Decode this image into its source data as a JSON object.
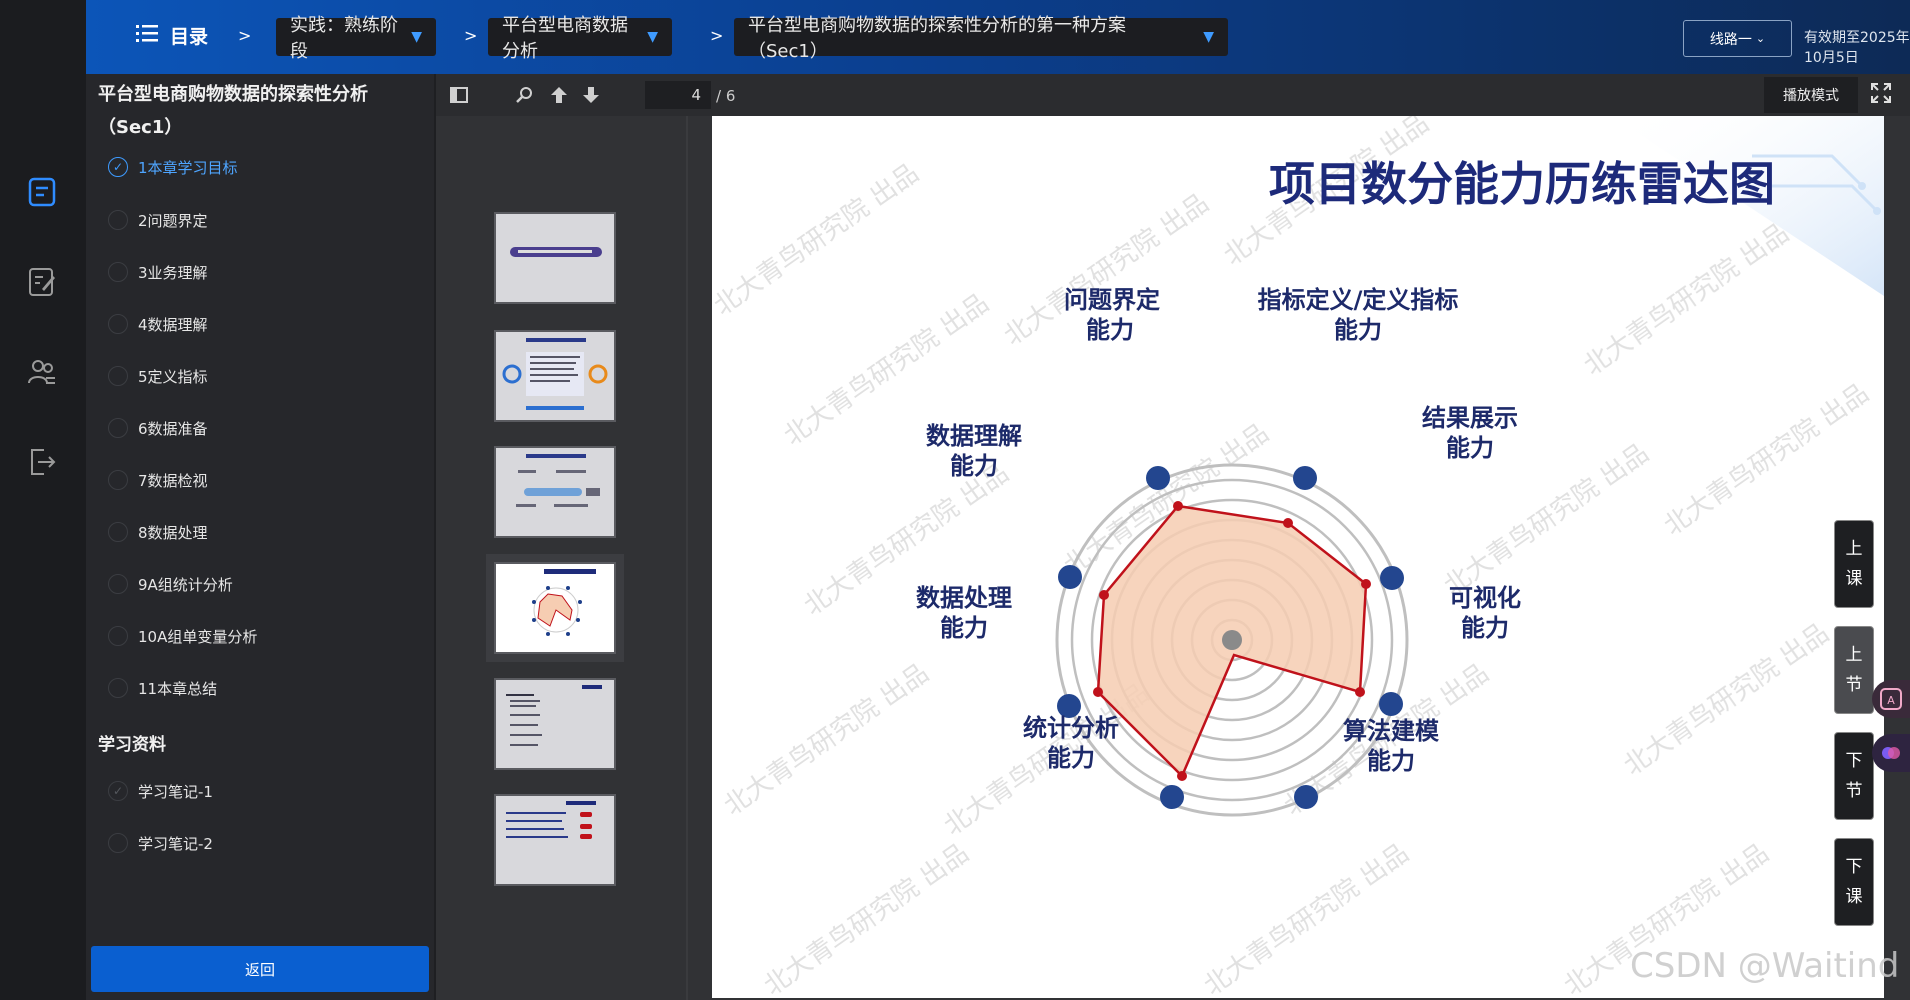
{
  "topbar": {
    "menu_label": "目录",
    "sep": ">",
    "crumbs": [
      "实践：熟练阶段",
      "平台型电商数据分析",
      "平台型电商购物数据的探索性分析的第一种方案（Sec1）"
    ],
    "route_label": "线路一",
    "expiry": "有效期至2025年10月5日"
  },
  "rail": {
    "icons": [
      "document-icon",
      "edit-note-icon",
      "people-icon",
      "exit-icon"
    ]
  },
  "toc": {
    "title": "平台型电商购物数据的探索性分析（Sec1）",
    "items": [
      "1本章学习目标",
      "2问题界定",
      "3业务理解",
      "4数据理解",
      "5定义指标",
      "6数据准备",
      "7数据检视",
      "8数据处理",
      "9A组统计分析",
      "10A组单变量分析",
      "11本章总结"
    ],
    "materials_heading": "学习资料",
    "materials": [
      "学习笔记-1",
      "学习笔记-2"
    ],
    "back_label": "返回"
  },
  "viewer": {
    "page_current": "4",
    "page_total": "/ 6",
    "present_label": "播放模式"
  },
  "slide": {
    "title": "项目数分能力历练雷达图",
    "labels": {
      "problem": [
        "问题界定",
        "能力"
      ],
      "metric": [
        "指标定义/定义指标",
        "能力"
      ],
      "result": [
        "结果展示",
        "能力"
      ],
      "vis": [
        "可视化",
        "能力"
      ],
      "algo": [
        "算法建模",
        "能力"
      ],
      "stats": [
        "统计分析",
        "能力"
      ],
      "process": [
        "数据处理",
        "能力"
      ],
      "understand": [
        "数据理解",
        "能力"
      ]
    },
    "watermark": "北大青鸟研究院 出品",
    "radar_color_fill": "#f6cdb2",
    "radar_color_line": "#c0121b",
    "dot_color": "#1e3f8a"
  },
  "side_nav": [
    [
      "上",
      "课"
    ],
    [
      "上",
      "节"
    ],
    [
      "下",
      "节"
    ],
    [
      "下",
      "课"
    ]
  ],
  "csdn_mark": "CSDN @Waitind"
}
